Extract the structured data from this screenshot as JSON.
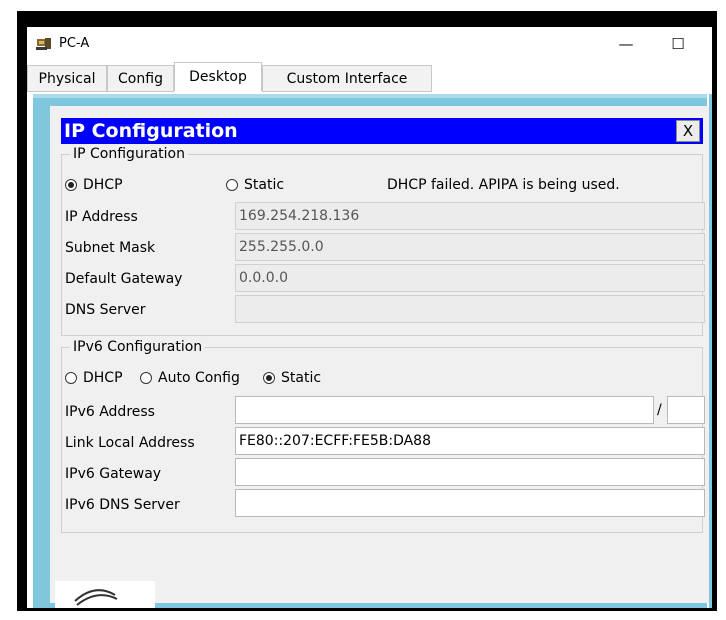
{
  "window": {
    "title": "PC-A",
    "minimize_symbol": "—",
    "maximize_symbol": "☐"
  },
  "tabs": [
    {
      "label": "Physical",
      "active": false
    },
    {
      "label": "Config",
      "active": false
    },
    {
      "label": "Desktop",
      "active": true
    },
    {
      "label": "Custom Interface",
      "active": false
    }
  ],
  "dialog": {
    "title": "IP Configuration",
    "close_label": "X"
  },
  "ipv4": {
    "legend": "IP Configuration",
    "dhcp_label": "DHCP",
    "static_label": "Static",
    "selected": "DHCP",
    "status": "DHCP failed. APIPA is being used.",
    "fields": {
      "ip_address": {
        "label": "IP Address",
        "value": "169.254.218.136"
      },
      "subnet_mask": {
        "label": "Subnet Mask",
        "value": "255.255.0.0"
      },
      "default_gateway": {
        "label": "Default Gateway",
        "value": "0.0.0.0"
      },
      "dns_server": {
        "label": "DNS Server",
        "value": ""
      }
    }
  },
  "ipv6": {
    "legend": "IPv6 Configuration",
    "dhcp_label": "DHCP",
    "auto_label": "Auto Config",
    "static_label": "Static",
    "selected": "Static",
    "prefix_separator": "/",
    "fields": {
      "ipv6_address": {
        "label": "IPv6 Address",
        "value": "",
        "prefix": ""
      },
      "link_local": {
        "label": "Link Local Address",
        "value": "FE80::207:ECFF:FE5B:DA88"
      },
      "ipv6_gateway": {
        "label": "IPv6 Gateway",
        "value": ""
      },
      "ipv6_dns": {
        "label": "IPv6 DNS Server",
        "value": ""
      }
    }
  },
  "colors": {
    "title_bar_blue": "#0000ff",
    "desktop_bg": "#7ec7dd",
    "dialog_bg": "#f0f0f0"
  },
  "icons": {
    "app": "pc-icon",
    "bottom": "desktop-app-icon"
  }
}
